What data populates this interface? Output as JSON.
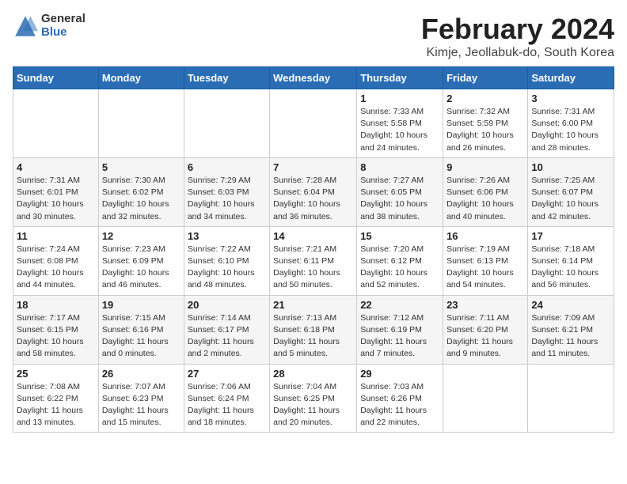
{
  "header": {
    "logo_general": "General",
    "logo_blue": "Blue",
    "title": "February 2024",
    "location": "Kimje, Jeollabuk-do, South Korea"
  },
  "weekdays": [
    "Sunday",
    "Monday",
    "Tuesday",
    "Wednesday",
    "Thursday",
    "Friday",
    "Saturday"
  ],
  "weeks": [
    [
      {
        "day": "",
        "info": ""
      },
      {
        "day": "",
        "info": ""
      },
      {
        "day": "",
        "info": ""
      },
      {
        "day": "",
        "info": ""
      },
      {
        "day": "1",
        "info": "Sunrise: 7:33 AM\nSunset: 5:58 PM\nDaylight: 10 hours and 24 minutes."
      },
      {
        "day": "2",
        "info": "Sunrise: 7:32 AM\nSunset: 5:59 PM\nDaylight: 10 hours and 26 minutes."
      },
      {
        "day": "3",
        "info": "Sunrise: 7:31 AM\nSunset: 6:00 PM\nDaylight: 10 hours and 28 minutes."
      }
    ],
    [
      {
        "day": "4",
        "info": "Sunrise: 7:31 AM\nSunset: 6:01 PM\nDaylight: 10 hours and 30 minutes."
      },
      {
        "day": "5",
        "info": "Sunrise: 7:30 AM\nSunset: 6:02 PM\nDaylight: 10 hours and 32 minutes."
      },
      {
        "day": "6",
        "info": "Sunrise: 7:29 AM\nSunset: 6:03 PM\nDaylight: 10 hours and 34 minutes."
      },
      {
        "day": "7",
        "info": "Sunrise: 7:28 AM\nSunset: 6:04 PM\nDaylight: 10 hours and 36 minutes."
      },
      {
        "day": "8",
        "info": "Sunrise: 7:27 AM\nSunset: 6:05 PM\nDaylight: 10 hours and 38 minutes."
      },
      {
        "day": "9",
        "info": "Sunrise: 7:26 AM\nSunset: 6:06 PM\nDaylight: 10 hours and 40 minutes."
      },
      {
        "day": "10",
        "info": "Sunrise: 7:25 AM\nSunset: 6:07 PM\nDaylight: 10 hours and 42 minutes."
      }
    ],
    [
      {
        "day": "11",
        "info": "Sunrise: 7:24 AM\nSunset: 6:08 PM\nDaylight: 10 hours and 44 minutes."
      },
      {
        "day": "12",
        "info": "Sunrise: 7:23 AM\nSunset: 6:09 PM\nDaylight: 10 hours and 46 minutes."
      },
      {
        "day": "13",
        "info": "Sunrise: 7:22 AM\nSunset: 6:10 PM\nDaylight: 10 hours and 48 minutes."
      },
      {
        "day": "14",
        "info": "Sunrise: 7:21 AM\nSunset: 6:11 PM\nDaylight: 10 hours and 50 minutes."
      },
      {
        "day": "15",
        "info": "Sunrise: 7:20 AM\nSunset: 6:12 PM\nDaylight: 10 hours and 52 minutes."
      },
      {
        "day": "16",
        "info": "Sunrise: 7:19 AM\nSunset: 6:13 PM\nDaylight: 10 hours and 54 minutes."
      },
      {
        "day": "17",
        "info": "Sunrise: 7:18 AM\nSunset: 6:14 PM\nDaylight: 10 hours and 56 minutes."
      }
    ],
    [
      {
        "day": "18",
        "info": "Sunrise: 7:17 AM\nSunset: 6:15 PM\nDaylight: 10 hours and 58 minutes."
      },
      {
        "day": "19",
        "info": "Sunrise: 7:15 AM\nSunset: 6:16 PM\nDaylight: 11 hours and 0 minutes."
      },
      {
        "day": "20",
        "info": "Sunrise: 7:14 AM\nSunset: 6:17 PM\nDaylight: 11 hours and 2 minutes."
      },
      {
        "day": "21",
        "info": "Sunrise: 7:13 AM\nSunset: 6:18 PM\nDaylight: 11 hours and 5 minutes."
      },
      {
        "day": "22",
        "info": "Sunrise: 7:12 AM\nSunset: 6:19 PM\nDaylight: 11 hours and 7 minutes."
      },
      {
        "day": "23",
        "info": "Sunrise: 7:11 AM\nSunset: 6:20 PM\nDaylight: 11 hours and 9 minutes."
      },
      {
        "day": "24",
        "info": "Sunrise: 7:09 AM\nSunset: 6:21 PM\nDaylight: 11 hours and 11 minutes."
      }
    ],
    [
      {
        "day": "25",
        "info": "Sunrise: 7:08 AM\nSunset: 6:22 PM\nDaylight: 11 hours and 13 minutes."
      },
      {
        "day": "26",
        "info": "Sunrise: 7:07 AM\nSunset: 6:23 PM\nDaylight: 11 hours and 15 minutes."
      },
      {
        "day": "27",
        "info": "Sunrise: 7:06 AM\nSunset: 6:24 PM\nDaylight: 11 hours and 18 minutes."
      },
      {
        "day": "28",
        "info": "Sunrise: 7:04 AM\nSunset: 6:25 PM\nDaylight: 11 hours and 20 minutes."
      },
      {
        "day": "29",
        "info": "Sunrise: 7:03 AM\nSunset: 6:26 PM\nDaylight: 11 hours and 22 minutes."
      },
      {
        "day": "",
        "info": ""
      },
      {
        "day": "",
        "info": ""
      }
    ]
  ]
}
